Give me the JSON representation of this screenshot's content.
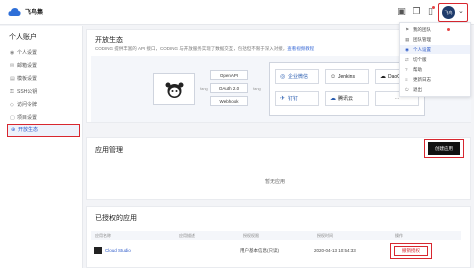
{
  "brand": "飞鸟集",
  "avatar_text": "飞鸟",
  "sidebar": {
    "title": "个人账户",
    "items": [
      {
        "label": "个人设置",
        "icon": "user-icon"
      },
      {
        "label": "邮箱设置",
        "icon": "mail-icon"
      },
      {
        "label": "模板设置",
        "icon": "template-icon"
      },
      {
        "label": "SSH公钥",
        "icon": "key-icon"
      },
      {
        "label": "访问令牌",
        "icon": "token-icon"
      },
      {
        "label": "项目设置",
        "icon": "project-icon"
      },
      {
        "label": "开放生态",
        "icon": "ecosystem-icon",
        "active": true
      }
    ]
  },
  "ecosystem": {
    "title": "开放生态",
    "desc": "CODING 提供丰富的 API 接口，CODING 与开放服务实现了数据交互，包括但不限于深入对接，",
    "desc_link": "查看视频教程",
    "link_label_left": "fang",
    "link_label_right": "fang",
    "apis": [
      "OpenAPI",
      "OAuth 2.0",
      "Webhook"
    ],
    "integrations": [
      {
        "name": "企业微信",
        "icon": "wecom-icon"
      },
      {
        "name": "Jenkins",
        "icon": "jenkins-icon"
      },
      {
        "name": "DaoCloud",
        "icon": "daocloud-icon"
      },
      {
        "name": "钉钉",
        "icon": "dingtalk-icon"
      },
      {
        "name": "腾讯云",
        "icon": "tencent-cloud-icon"
      },
      {
        "name": "···",
        "icon": "more-icon"
      }
    ]
  },
  "apps": {
    "title": "应用管理",
    "create_label": "创建应用",
    "empty_text": "暂无应用"
  },
  "authorized": {
    "title": "已授权的应用",
    "columns": [
      "应用名称",
      "应用描述",
      "授权权限",
      "授权时间",
      "操作"
    ],
    "rows": [
      {
        "name": "Cloud Studio",
        "desc": "",
        "scope": "用户基本信息(只读)",
        "time": "2020-04-13 10:54:33",
        "action": "撤销授权"
      }
    ]
  },
  "dropdown": {
    "items": [
      {
        "label": "我的团队",
        "icon": "team-icon",
        "dot": true
      },
      {
        "label": "团队管理",
        "icon": "manage-icon"
      },
      {
        "label": "个人设置",
        "icon": "settings-icon",
        "highlight": true
      },
      {
        "label": "切个版",
        "icon": "switch-icon"
      },
      {
        "label": "帮助",
        "icon": "help-icon"
      },
      {
        "label": "更新日志",
        "icon": "changelog-icon"
      },
      {
        "label": "退出",
        "icon": "logout-icon"
      }
    ]
  },
  "colors": {
    "accent": "#2e5bc9",
    "highlight_frame": "#d8272f",
    "button_dark": "#111111"
  }
}
